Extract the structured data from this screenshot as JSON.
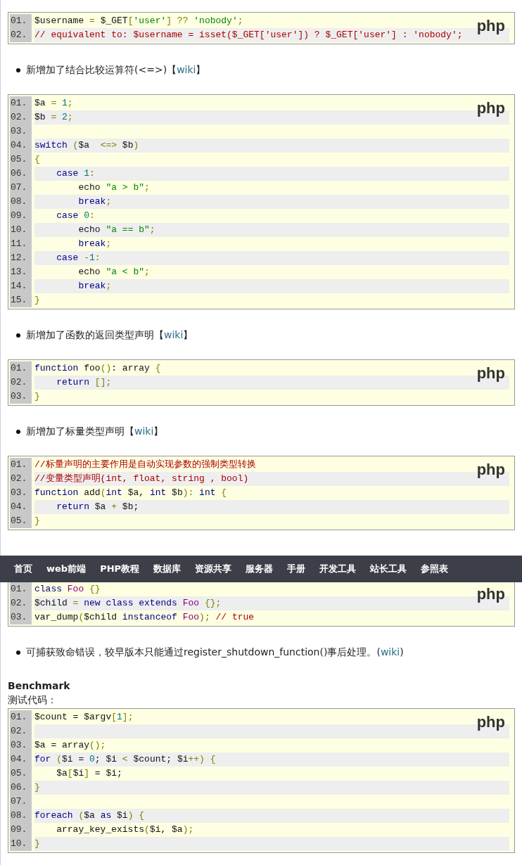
{
  "sections": [
    {
      "kind": "code",
      "label": "php",
      "lines": [
        {
          "num": "01.",
          "tokens": [
            {
              "kind": "plain",
              "text": "$username"
            },
            {
              "kind": "op",
              "text": " = "
            },
            {
              "kind": "plain",
              "text": "$_GET"
            },
            {
              "kind": "op",
              "text": "["
            },
            {
              "kind": "str",
              "text": "'user'"
            },
            {
              "kind": "op",
              "text": "] ?? "
            },
            {
              "kind": "str",
              "text": "'nobody'"
            },
            {
              "kind": "op",
              "text": ";"
            }
          ]
        },
        {
          "num": "02.",
          "tokens": [
            {
              "kind": "com",
              "text": "// equivalent to: $username = isset($_GET['user']) ? $_GET['user'] : 'nobody';"
            }
          ]
        }
      ]
    },
    {
      "kind": "bullet",
      "text": "新增加了结合比较运算符(<=>)【",
      "link": "wiki",
      "after": "】"
    },
    {
      "kind": "code",
      "label": "php",
      "lines": [
        {
          "num": "01.",
          "tokens": [
            {
              "kind": "plain",
              "text": "$a"
            },
            {
              "kind": "op",
              "text": " = "
            },
            {
              "kind": "num",
              "text": "1"
            },
            {
              "kind": "op",
              "text": ";"
            }
          ]
        },
        {
          "num": "02.",
          "tokens": [
            {
              "kind": "plain",
              "text": "$b"
            },
            {
              "kind": "op",
              "text": " = "
            },
            {
              "kind": "num",
              "text": "2"
            },
            {
              "kind": "op",
              "text": ";"
            }
          ]
        },
        {
          "num": "03."
        },
        {
          "num": "04.",
          "tokens": [
            {
              "kind": "kw",
              "text": "switch"
            },
            {
              "kind": "op",
              "text": " ("
            },
            {
              "kind": "plain",
              "text": "$a  "
            },
            {
              "kind": "op",
              "text": "<=>"
            },
            {
              "kind": "plain",
              "text": " $b"
            },
            {
              "kind": "op",
              "text": ")"
            }
          ]
        },
        {
          "num": "05.",
          "tokens": [
            {
              "kind": "op",
              "text": "{"
            }
          ]
        },
        {
          "num": "06.",
          "tokens": [
            {
              "kind": "kw",
              "text": "    case "
            },
            {
              "kind": "num",
              "text": "1"
            },
            {
              "kind": "op",
              "text": ":"
            }
          ]
        },
        {
          "num": "07.",
          "tokens": [
            {
              "kind": "plain",
              "text": "        echo "
            },
            {
              "kind": "str",
              "text": "\"a > b\""
            },
            {
              "kind": "op",
              "text": ";"
            }
          ]
        },
        {
          "num": "08.",
          "tokens": [
            {
              "kind": "kw",
              "text": "        break"
            },
            {
              "kind": "op",
              "text": ";"
            }
          ]
        },
        {
          "num": "09.",
          "tokens": [
            {
              "kind": "kw",
              "text": "    case "
            },
            {
              "kind": "num",
              "text": "0"
            },
            {
              "kind": "op",
              "text": ":"
            }
          ]
        },
        {
          "num": "10.",
          "tokens": [
            {
              "kind": "plain",
              "text": "        echo "
            },
            {
              "kind": "str",
              "text": "\"a == b\""
            },
            {
              "kind": "op",
              "text": ";"
            }
          ]
        },
        {
          "num": "11.",
          "tokens": [
            {
              "kind": "kw",
              "text": "        break"
            },
            {
              "kind": "op",
              "text": ";"
            }
          ]
        },
        {
          "num": "12.",
          "tokens": [
            {
              "kind": "kw",
              "text": "    case "
            },
            {
              "kind": "op",
              "text": "-"
            },
            {
              "kind": "num",
              "text": "1"
            },
            {
              "kind": "op",
              "text": ":"
            }
          ]
        },
        {
          "num": "13.",
          "tokens": [
            {
              "kind": "plain",
              "text": "        echo "
            },
            {
              "kind": "str",
              "text": "\"a < b\""
            },
            {
              "kind": "op",
              "text": ";"
            }
          ]
        },
        {
          "num": "14.",
          "tokens": [
            {
              "kind": "kw",
              "text": "        break"
            },
            {
              "kind": "op",
              "text": ";"
            }
          ]
        },
        {
          "num": "15.",
          "tokens": [
            {
              "kind": "op",
              "text": "}"
            }
          ]
        }
      ]
    },
    {
      "kind": "bullet",
      "text": "新增加了函数的返回类型声明【",
      "link": "wiki",
      "after": "】"
    },
    {
      "kind": "code",
      "label": "php",
      "lines": [
        {
          "num": "01.",
          "tokens": [
            {
              "kind": "kw",
              "text": "function"
            },
            {
              "kind": "plain",
              "text": " foo"
            },
            {
              "kind": "op",
              "text": "()"
            },
            {
              "kind": "plain",
              "text": ": array "
            },
            {
              "kind": "op",
              "text": "{"
            }
          ]
        },
        {
          "num": "02.",
          "tokens": [
            {
              "kind": "kw",
              "text": "    return "
            },
            {
              "kind": "op",
              "text": "[];"
            }
          ]
        },
        {
          "num": "03.",
          "tokens": [
            {
              "kind": "op",
              "text": "}"
            }
          ]
        }
      ]
    },
    {
      "kind": "bullet",
      "text": "新增加了标量类型声明【",
      "link": "wiki",
      "after": "】"
    },
    {
      "kind": "code",
      "label": "php",
      "lines": [
        {
          "num": "01.",
          "tokens": [
            {
              "kind": "com",
              "text": "//标量声明的主要作用是自动实现参数的强制类型转换"
            }
          ]
        },
        {
          "num": "02.",
          "tokens": [
            {
              "kind": "com",
              "text": "//变量类型声明(int, float, string , bool)"
            }
          ]
        },
        {
          "num": "03.",
          "tokens": [
            {
              "kind": "kw",
              "text": "function"
            },
            {
              "kind": "plain",
              "text": " add"
            },
            {
              "kind": "op",
              "text": "("
            },
            {
              "kind": "kw",
              "text": "int"
            },
            {
              "kind": "plain",
              "text": " $a, "
            },
            {
              "kind": "kw",
              "text": "int"
            },
            {
              "kind": "plain",
              "text": " $b"
            },
            {
              "kind": "op",
              "text": "): "
            },
            {
              "kind": "kw",
              "text": "int "
            },
            {
              "kind": "op",
              "text": "{"
            }
          ]
        },
        {
          "num": "04.",
          "tokens": [
            {
              "kind": "kw",
              "text": "    return"
            },
            {
              "kind": "plain",
              "text": " $a "
            },
            {
              "kind": "op",
              "text": "+"
            },
            {
              "kind": "plain",
              "text": " $b;"
            }
          ]
        },
        {
          "num": "05.",
          "tokens": [
            {
              "kind": "op",
              "text": "}"
            }
          ]
        }
      ]
    },
    {
      "kind": "code",
      "label": "php",
      "lines": [
        {
          "num": "01.",
          "tokens": [
            {
              "kind": "kw",
              "text": "class "
            },
            {
              "kind": "cls",
              "text": "Foo "
            },
            {
              "kind": "op",
              "text": "{}"
            }
          ]
        },
        {
          "num": "02.",
          "tokens": [
            {
              "kind": "plain",
              "text": "$child "
            },
            {
              "kind": "op",
              "text": "= "
            },
            {
              "kind": "kw",
              "text": "new class extends "
            },
            {
              "kind": "cls",
              "text": "Foo "
            },
            {
              "kind": "op",
              "text": "{};"
            }
          ]
        },
        {
          "num": "03.",
          "tokens": [
            {
              "kind": "plain",
              "text": "var_dump"
            },
            {
              "kind": "op",
              "text": "("
            },
            {
              "kind": "plain",
              "text": "$child "
            },
            {
              "kind": "kw",
              "text": "instanceof "
            },
            {
              "kind": "cls",
              "text": "Foo"
            },
            {
              "kind": "op",
              "text": "); "
            },
            {
              "kind": "com",
              "text": "// true"
            }
          ]
        }
      ]
    },
    {
      "kind": "bullet",
      "text": "可捕获致命错误，较早版本只能通过register_shutdown_function()事后处理。(",
      "link": "wiki",
      "after": ")"
    },
    {
      "kind": "heading",
      "text": "Benchmark"
    },
    {
      "kind": "para",
      "text": "测试代码："
    },
    {
      "kind": "code",
      "label": "php",
      "lines": [
        {
          "num": "01.",
          "tokens": [
            {
              "kind": "plain",
              "text": "$count = $argv"
            },
            {
              "kind": "op",
              "text": "["
            },
            {
              "kind": "num",
              "text": "1"
            },
            {
              "kind": "op",
              "text": "];"
            }
          ]
        },
        {
          "num": "02."
        },
        {
          "num": "03.",
          "tokens": [
            {
              "kind": "plain",
              "text": "$a = array"
            },
            {
              "kind": "op",
              "text": "();"
            }
          ]
        },
        {
          "num": "04.",
          "tokens": [
            {
              "kind": "kw",
              "text": "for"
            },
            {
              "kind": "op",
              "text": " ("
            },
            {
              "kind": "plain",
              "text": "$i = "
            },
            {
              "kind": "num",
              "text": "0"
            },
            {
              "kind": "plain",
              "text": "; $i "
            },
            {
              "kind": "op",
              "text": "<"
            },
            {
              "kind": "plain",
              "text": " $count; $i"
            },
            {
              "kind": "op",
              "text": "++) {"
            }
          ]
        },
        {
          "num": "05.",
          "tokens": [
            {
              "kind": "plain",
              "text": "    $a"
            },
            {
              "kind": "op",
              "text": "["
            },
            {
              "kind": "plain",
              "text": "$i"
            },
            {
              "kind": "op",
              "text": "]"
            },
            {
              "kind": "plain",
              "text": " = $i;"
            }
          ]
        },
        {
          "num": "06.",
          "tokens": [
            {
              "kind": "op",
              "text": "}"
            }
          ]
        },
        {
          "num": "07."
        },
        {
          "num": "08.",
          "tokens": [
            {
              "kind": "kw",
              "text": "foreach"
            },
            {
              "kind": "op",
              "text": " ("
            },
            {
              "kind": "plain",
              "text": "$a "
            },
            {
              "kind": "kw",
              "text": "as"
            },
            {
              "kind": "plain",
              "text": " $i"
            },
            {
              "kind": "op",
              "text": ") {"
            }
          ]
        },
        {
          "num": "09.",
          "tokens": [
            {
              "kind": "plain",
              "text": "    array_key_exists"
            },
            {
              "kind": "op",
              "text": "("
            },
            {
              "kind": "plain",
              "text": "$i, $a"
            },
            {
              "kind": "op",
              "text": ");"
            }
          ]
        },
        {
          "num": "10.",
          "tokens": [
            {
              "kind": "op",
              "text": "}"
            }
          ]
        }
      ]
    }
  ],
  "nav": [
    "首页",
    "web前端",
    "PHP教程",
    "数据库",
    "资源共享",
    "服务器",
    "手册",
    "开发工具",
    "站长工具",
    "参照表"
  ]
}
